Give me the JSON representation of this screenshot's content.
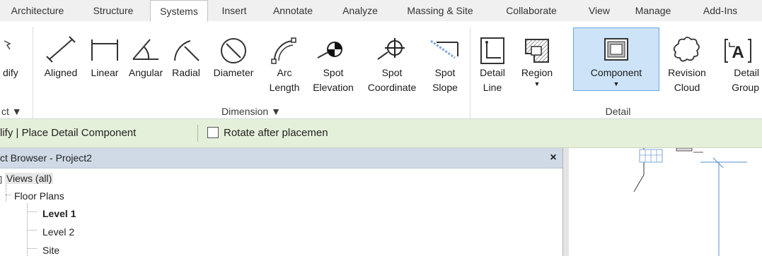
{
  "tabs": [
    {
      "label": "Architecture",
      "active": false
    },
    {
      "label": "Structure",
      "active": false
    },
    {
      "label": "Systems",
      "active": true
    },
    {
      "label": "Insert",
      "active": false
    },
    {
      "label": "Annotate",
      "active": false
    },
    {
      "label": "Analyze",
      "active": false
    },
    {
      "label": "Massing & Site",
      "active": false
    },
    {
      "label": "Collaborate",
      "active": false
    },
    {
      "label": "View",
      "active": false
    },
    {
      "label": "Manage",
      "active": false
    },
    {
      "label": "Add-Ins",
      "active": false
    }
  ],
  "ribbon": {
    "modify_label": "dify",
    "select_panel_label": "ct ▼",
    "dimension": {
      "panel_label": "Dimension ▼",
      "buttons": [
        {
          "label": "Aligned",
          "icon": "aligned-dimension-icon"
        },
        {
          "label": "Linear",
          "icon": "linear-dimension-icon"
        },
        {
          "label": "Angular",
          "icon": "angular-dimension-icon"
        },
        {
          "label": "Radial",
          "icon": "radial-dimension-icon"
        },
        {
          "label": "Diameter",
          "icon": "diameter-dimension-icon"
        },
        {
          "label": "Arc\nLength",
          "icon": "arc-length-icon"
        },
        {
          "label": "Spot\nElevation",
          "icon": "spot-elevation-icon"
        },
        {
          "label": "Spot\nCoordinate",
          "icon": "spot-coordinate-icon"
        },
        {
          "label": "Spot\nSlope",
          "icon": "spot-slope-icon"
        }
      ]
    },
    "detail": {
      "panel_label": "Detail",
      "buttons": [
        {
          "label": "Detail\nLine",
          "icon": "detail-line-icon"
        },
        {
          "label": "Region",
          "icon": "region-icon"
        },
        {
          "label": "Component",
          "icon": "component-icon",
          "selected": true
        },
        {
          "label": "Revision\nCloud",
          "icon": "revision-cloud-icon"
        },
        {
          "label": "Detail\nGroup",
          "icon": "detail-group-icon"
        }
      ]
    }
  },
  "options_bar": {
    "context_label": "lify | Place Detail Component",
    "rotate_checkbox_label": "Rotate after placemen",
    "rotate_checked": false
  },
  "project_browser": {
    "title": "ct Browser - Project2",
    "close_glyph": "×",
    "views_label": "Views (all)",
    "floor_plans_label": "Floor Plans",
    "levels": [
      "Level 1",
      "Level 2",
      "Site"
    ]
  },
  "colors": {
    "options_bar_bg": "#e5f0da",
    "browser_header_bg": "#cfdae6",
    "selected_button_bg": "#cde3f7",
    "canvas_line": "#5b8fd0"
  }
}
